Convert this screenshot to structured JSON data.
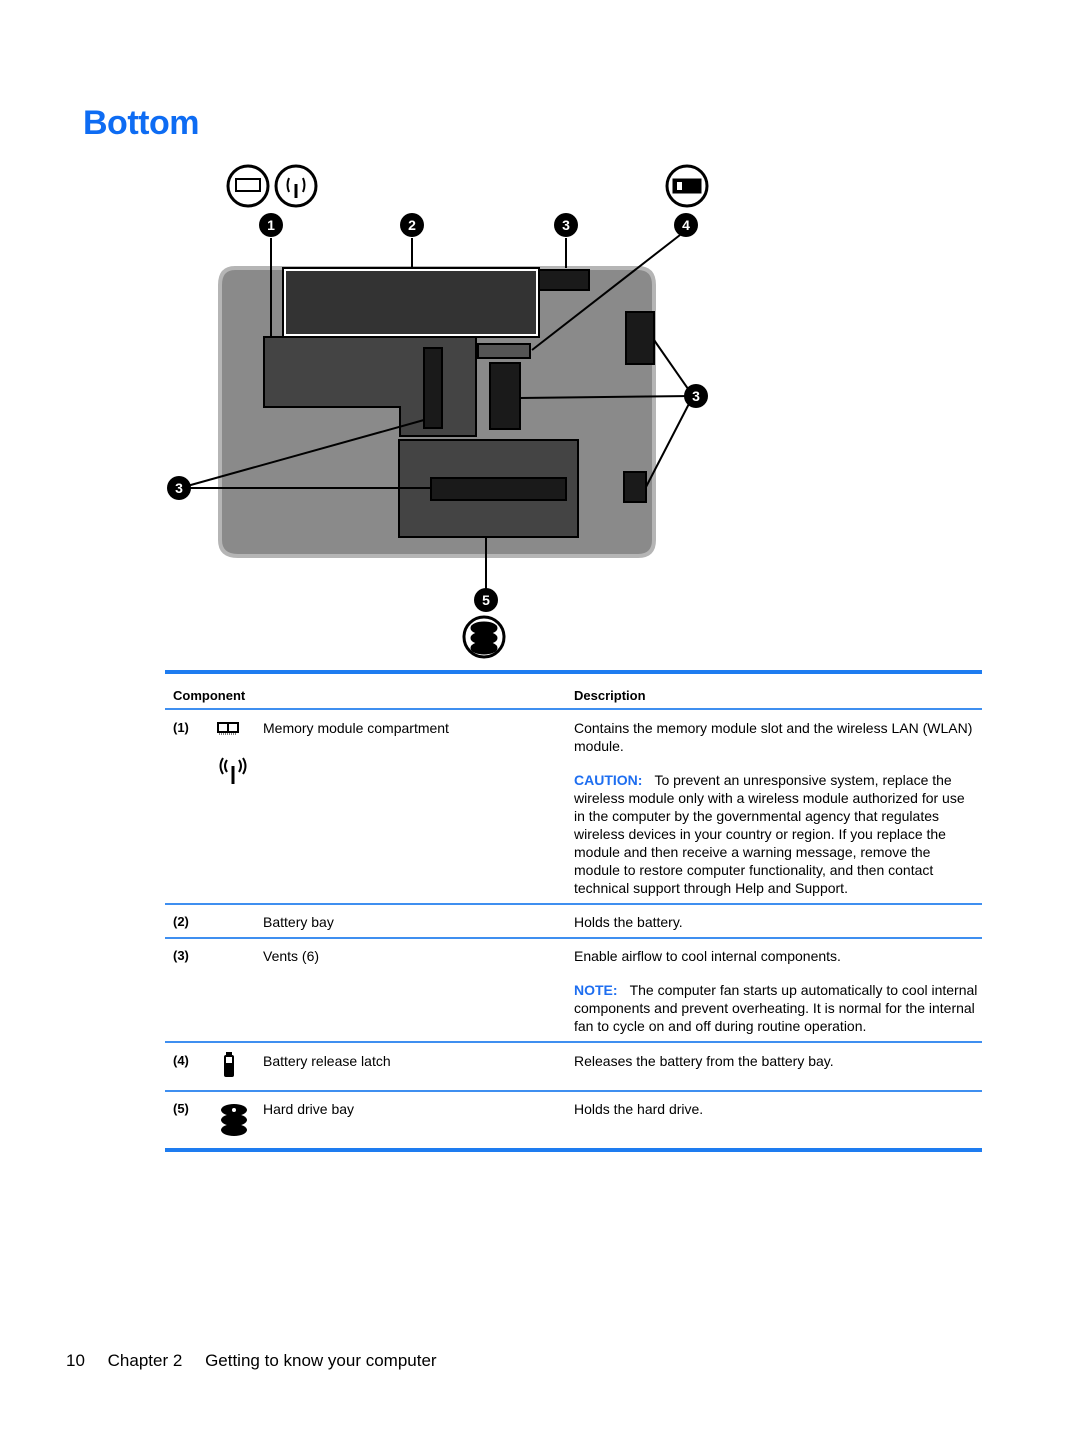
{
  "page": {
    "heading": "Bottom",
    "footer": {
      "page_number": "10",
      "chapter": "Chapter 2",
      "chapter_title": "Getting to know your computer"
    }
  },
  "colors": {
    "heading": "#0e6cf3",
    "rule": "#1e7cf0",
    "label": "#1e6ef0"
  },
  "figure": {
    "callouts": [
      "1",
      "2",
      "3",
      "4",
      "3",
      "3",
      "5"
    ],
    "top_icons": [
      "memory-module-icon",
      "wireless-icon",
      "battery-icon"
    ],
    "bottom_icon": "hard-drive-icon"
  },
  "table": {
    "headers": {
      "component": "Component",
      "description": "Description"
    },
    "rows": [
      {
        "num": "(1)",
        "icons": [
          "memory-module-icon",
          "wireless-icon"
        ],
        "component": "Memory module compartment",
        "description": "Contains the memory module slot and the wireless LAN (WLAN) module.",
        "note_label": "CAUTION:",
        "note_text": "To prevent an unresponsive system, replace the wireless module only with a wireless module authorized for use in the computer by the governmental agency that regulates wireless devices in your country or region. If you replace the module and then receive a warning message, remove the module to restore computer functionality, and then contact technical support through Help and Support."
      },
      {
        "num": "(2)",
        "component": "Battery bay",
        "description": "Holds the battery."
      },
      {
        "num": "(3)",
        "component": "Vents (6)",
        "description": "Enable airflow to cool internal components.",
        "note_label": "NOTE:",
        "note_text": "The computer fan starts up automatically to cool internal components and prevent overheating. It is normal for the internal fan to cycle on and off during routine operation."
      },
      {
        "num": "(4)",
        "icons": [
          "battery-icon"
        ],
        "component": "Battery release latch",
        "description": "Releases the battery from the battery bay."
      },
      {
        "num": "(5)",
        "icons": [
          "hard-drive-icon"
        ],
        "component": "Hard drive bay",
        "description": "Holds the hard drive."
      }
    ]
  }
}
